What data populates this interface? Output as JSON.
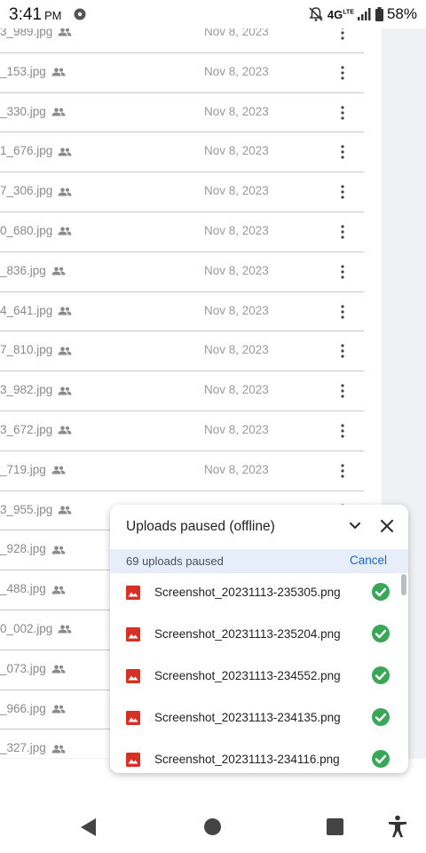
{
  "status_bar": {
    "time": "3:41",
    "ampm": "PM",
    "network": "4G",
    "network_sup": "LTE",
    "battery": "58%"
  },
  "file_list": [
    {
      "name": "3_989.jpg",
      "date": "Nov 8, 2023"
    },
    {
      "name": "_153.jpg",
      "date": "Nov 8, 2023"
    },
    {
      "name": "_330.jpg",
      "date": "Nov 8, 2023"
    },
    {
      "name": "1_676.jpg",
      "date": "Nov 8, 2023"
    },
    {
      "name": "7_306.jpg",
      "date": "Nov 8, 2023"
    },
    {
      "name": "0_680.jpg",
      "date": "Nov 8, 2023"
    },
    {
      "name": "_836.jpg",
      "date": "Nov 8, 2023"
    },
    {
      "name": "4_641.jpg",
      "date": "Nov 8, 2023"
    },
    {
      "name": "7_810.jpg",
      "date": "Nov 8, 2023"
    },
    {
      "name": "3_982.jpg",
      "date": "Nov 8, 2023"
    },
    {
      "name": "3_672.jpg",
      "date": "Nov 8, 2023"
    },
    {
      "name": "_719.jpg",
      "date": "Nov 8, 2023"
    },
    {
      "name": "3_955.jpg",
      "date": "Nov 8, 2023"
    },
    {
      "name": "_928.jpg",
      "date": ""
    },
    {
      "name": "_488.jpg",
      "date": ""
    },
    {
      "name": "0_002.jpg",
      "date": ""
    },
    {
      "name": "_073.jpg",
      "date": ""
    },
    {
      "name": "_966.jpg",
      "date": ""
    },
    {
      "name": "_327.jpg",
      "date": ""
    }
  ],
  "upload_panel": {
    "title": "Uploads paused (offline)",
    "count_text": "69 uploads paused",
    "cancel_label": "Cancel",
    "items": [
      {
        "name": "Screenshot_20231113-235305.png"
      },
      {
        "name": "Screenshot_20231113-235204.png"
      },
      {
        "name": "Screenshot_20231113-234552.png"
      },
      {
        "name": "Screenshot_20231113-234135.png"
      },
      {
        "name": "Screenshot_20231113-234116.png"
      }
    ]
  },
  "icons": {
    "shared": "shared-people-icon",
    "more": "more-vert-icon",
    "image": "image-file-icon",
    "check": "check-circle-icon",
    "collapse": "chevron-down-icon",
    "close": "close-icon",
    "back": "back-triangle-icon",
    "home": "home-circle-icon",
    "recents": "recents-square-icon",
    "accessibility": "accessibility-icon"
  },
  "colors": {
    "accent": "#1a66c9",
    "check_green": "#3aa657",
    "image_icon_red": "#d93025",
    "sub_header_bg": "#e8eef9"
  }
}
